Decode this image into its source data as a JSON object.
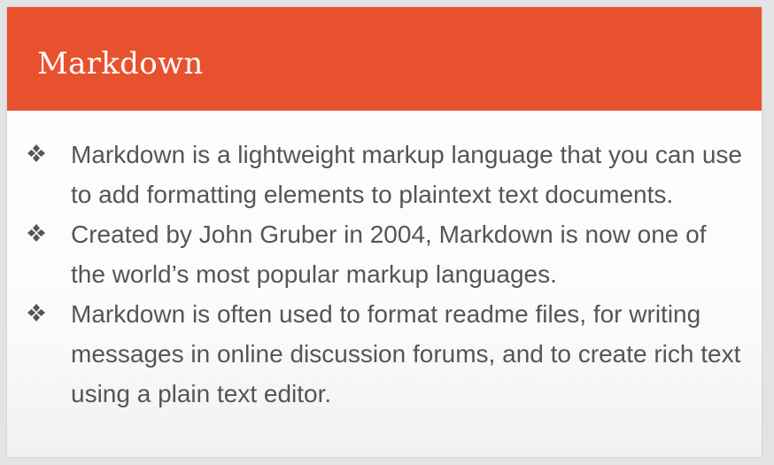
{
  "slide": {
    "title": "Markdown",
    "accent_color": "#e8512e",
    "bullet_icon": "four-diamond-bullet-icon",
    "bullets": [
      {
        "text": "Markdown is a lightweight markup language that you can use to add formatting elements to plaintext text documents."
      },
      {
        "text": "Created by John Gruber in 2004, Markdown is now one of the world’s most popular markup languages."
      },
      {
        "text": "Markdown is often used to format readme files, for writing messages in online discussion forums, and to create rich text using a plain text editor."
      }
    ]
  }
}
